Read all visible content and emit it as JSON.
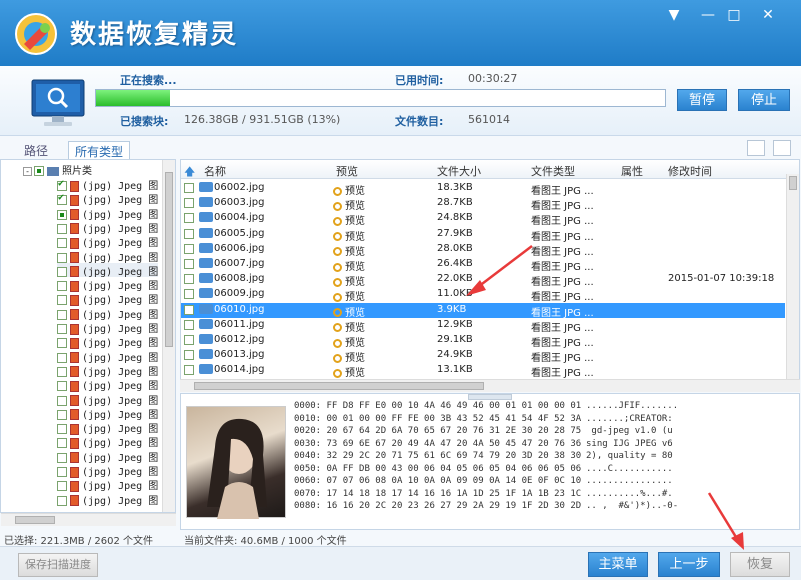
{
  "app": {
    "title": "数据恢复精灵"
  },
  "window": {
    "help_icon": "▼",
    "min_icon": "—",
    "max_icon": "□",
    "close_icon": "✕"
  },
  "status": {
    "searching_label": "正在搜索...",
    "elapsed_label": "已用时间:",
    "elapsed_value": "00:30:27",
    "searched_label": "已搜索块:",
    "searched_value": "126.38GB / 931.51GB (13%)",
    "file_count_label": "文件数目:",
    "file_count_value": "561014",
    "progress_percent": 13,
    "pause_button": "暂停",
    "stop_button": "停止"
  },
  "tabs": [
    {
      "label": "路径"
    },
    {
      "label": "所有类型"
    }
  ],
  "tree": {
    "root_label": "照片类",
    "items": [
      {
        "label": "(jpg) Jpeg 图",
        "state": "checked"
      },
      {
        "label": "(jpg) Jpeg 图",
        "state": "checked"
      },
      {
        "label": "(jpg) Jpeg 图",
        "state": "partial"
      },
      {
        "label": "(jpg) Jpeg 图",
        "state": "none"
      },
      {
        "label": "(jpg) Jpeg 图",
        "state": "none"
      },
      {
        "label": "(jpg) Jpeg 图",
        "state": "none"
      },
      {
        "label": "(jpg) Jpeg 图",
        "state": "none"
      },
      {
        "label": "(jpg) Jpeg 图",
        "state": "none"
      },
      {
        "label": "(jpg) Jpeg 图",
        "state": "none"
      },
      {
        "label": "(jpg) Jpeg 图",
        "state": "none"
      },
      {
        "label": "(jpg) Jpeg 图",
        "state": "none"
      },
      {
        "label": "(jpg) Jpeg 图",
        "state": "none"
      },
      {
        "label": "(jpg) Jpeg 图",
        "state": "none"
      },
      {
        "label": "(jpg) Jpeg 图",
        "state": "none"
      },
      {
        "label": "(jpg) Jpeg 图",
        "state": "none"
      },
      {
        "label": "(jpg) Jpeg 图",
        "state": "none"
      },
      {
        "label": "(jpg) Jpeg 图",
        "state": "none"
      },
      {
        "label": "(jpg) Jpeg 图",
        "state": "none"
      },
      {
        "label": "(jpg) Jpeg 图",
        "state": "none"
      },
      {
        "label": "(jpg) Jpeg 图",
        "state": "none"
      },
      {
        "label": "(jpg) Jpeg 图",
        "state": "none"
      },
      {
        "label": "(jpg) Jpeg 图",
        "state": "none"
      },
      {
        "label": "(jpg) Jpeg 图",
        "state": "none"
      }
    ]
  },
  "list": {
    "columns": [
      "名称",
      "预览",
      "文件大小",
      "文件类型",
      "属性",
      "修改时间"
    ],
    "rows": [
      {
        "name": "06002.jpg",
        "preview": "预览",
        "size": "18.3KB",
        "type": "看图王 JPG ...",
        "attr": "",
        "mtime": "",
        "selected": false
      },
      {
        "name": "06003.jpg",
        "preview": "预览",
        "size": "28.7KB",
        "type": "看图王 JPG ...",
        "attr": "",
        "mtime": "",
        "selected": false
      },
      {
        "name": "06004.jpg",
        "preview": "预览",
        "size": "24.8KB",
        "type": "看图王 JPG ...",
        "attr": "",
        "mtime": "",
        "selected": false
      },
      {
        "name": "06005.jpg",
        "preview": "预览",
        "size": "27.9KB",
        "type": "看图王 JPG ...",
        "attr": "",
        "mtime": "",
        "selected": false
      },
      {
        "name": "06006.jpg",
        "preview": "预览",
        "size": "28.0KB",
        "type": "看图王 JPG ...",
        "attr": "",
        "mtime": "",
        "selected": false
      },
      {
        "name": "06007.jpg",
        "preview": "预览",
        "size": "26.4KB",
        "type": "看图王 JPG ...",
        "attr": "",
        "mtime": "",
        "selected": false
      },
      {
        "name": "06008.jpg",
        "preview": "预览",
        "size": "22.0KB",
        "type": "看图王 JPG ...",
        "attr": "",
        "mtime": "2015-01-07 10:39:18",
        "selected": false
      },
      {
        "name": "06009.jpg",
        "preview": "预览",
        "size": "11.0KB",
        "type": "看图王 JPG ...",
        "attr": "",
        "mtime": "",
        "selected": false
      },
      {
        "name": "06010.jpg",
        "preview": "预览",
        "size": "3.9KB",
        "type": "看图王 JPG ...",
        "attr": "",
        "mtime": "",
        "selected": true
      },
      {
        "name": "06011.jpg",
        "preview": "预览",
        "size": "12.9KB",
        "type": "看图王 JPG ...",
        "attr": "",
        "mtime": "",
        "selected": false
      },
      {
        "name": "06012.jpg",
        "preview": "预览",
        "size": "29.1KB",
        "type": "看图王 JPG ...",
        "attr": "",
        "mtime": "",
        "selected": false
      },
      {
        "name": "06013.jpg",
        "preview": "预览",
        "size": "24.9KB",
        "type": "看图王 JPG ...",
        "attr": "",
        "mtime": "",
        "selected": false
      },
      {
        "name": "06014.jpg",
        "preview": "预览",
        "size": "13.1KB",
        "type": "看图王 JPG ...",
        "attr": "",
        "mtime": "",
        "selected": false
      }
    ]
  },
  "hex": {
    "lines": [
      "0000: FF D8 FF E0 00 10 4A 46 49 46 00 01 01 00 00 01",
      "0010: 00 01 00 00 FF FE 00 3B 43 52 45 41 54 4F 52 3A",
      "0020: 20 67 64 2D 6A 70 65 67 20 76 31 2E 30 20 28 75",
      "0030: 73 69 6E 67 20 49 4A 47 20 4A 50 45 47 20 76 36",
      "0040: 32 29 2C 20 71 75 61 6C 69 74 79 20 3D 20 38 30",
      "0050: 0A FF DB 00 43 00 06 04 05 06 05 04 06 06 05 06",
      "0060: 07 07 06 08 0A 10 0A 0A 09 09 0A 14 0E 0F 0C 10",
      "0070: 17 14 18 18 17 14 16 16 1A 1D 25 1F 1A 1B 23 1C",
      "0080: 16 16 20 2C 20 23 26 27 29 2A 29 19 1F 2D 30 2D"
    ],
    "ascii": [
      "......JFIF.......",
      ".......;CREATOR:",
      " gd-jpeg v1.0 (u",
      "sing IJG JPEG v6",
      "2), quality = 80",
      "....C...........",
      "................",
      "..........%...#.",
      ".. ,  #&')*)..-0-"
    ]
  },
  "footer": {
    "selected": "已选择: 221.3MB / 2602 个文件",
    "current_folder": "当前文件夹: 40.6MB / 1000 个文件"
  },
  "buttons": {
    "save_progress": "保存扫描进度",
    "main_menu": "主菜单",
    "previous": "上一步",
    "recover": "恢复"
  }
}
